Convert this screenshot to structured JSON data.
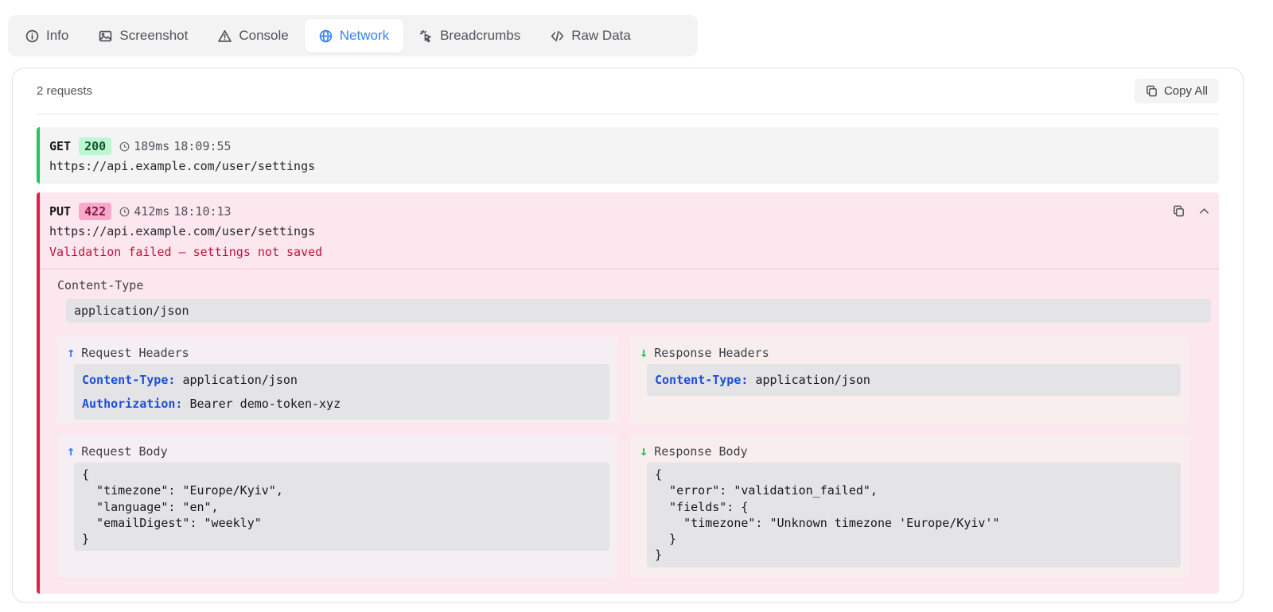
{
  "tabs": [
    {
      "label": "Info",
      "icon": "info-icon",
      "active": false
    },
    {
      "label": "Screenshot",
      "icon": "image-icon",
      "active": false
    },
    {
      "label": "Console",
      "icon": "warning-triangle-icon",
      "active": false
    },
    {
      "label": "Network",
      "icon": "globe-icon",
      "active": true
    },
    {
      "label": "Breadcrumbs",
      "icon": "pointer-click-icon",
      "active": false
    },
    {
      "label": "Raw Data",
      "icon": "code-icon",
      "active": false
    }
  ],
  "network": {
    "request_count": "2 requests",
    "copy_all_label": "Copy All",
    "requests": [
      {
        "method": "GET",
        "status": "200",
        "status_color": "#22c55e",
        "duration": "189ms",
        "time": "18:09:55",
        "url": "https://api.example.com/user/settings"
      },
      {
        "method": "PUT",
        "status": "422",
        "status_color": "#e11d48",
        "duration": "412ms",
        "time": "18:10:13",
        "url": "https://api.example.com/user/settings",
        "error": "Validation failed — settings not saved",
        "expanded": true,
        "content_type_label": "Content-Type",
        "content_type_value": "application/json",
        "request_headers_title": "Request Headers",
        "response_headers_title": "Response Headers",
        "request_headers": [
          {
            "key": "Content-Type:",
            "value": "application/json"
          },
          {
            "key": "Authorization:",
            "value": "Bearer demo-token-xyz"
          }
        ],
        "response_headers": [
          {
            "key": "Content-Type:",
            "value": "application/json"
          }
        ],
        "request_body_title": "Request Body",
        "response_body_title": "Response Body",
        "request_body": [
          "{",
          "  \"timezone\": \"Europe/Kyiv\",",
          "  \"language\": \"en\",",
          "  \"emailDigest\": \"weekly\"",
          "}"
        ],
        "response_body": [
          "{",
          "  \"error\": \"validation_failed\",",
          "  \"fields\": {",
          "    \"timezone\": \"Unknown timezone 'Europe/Kyiv'\"",
          "  }",
          "}"
        ]
      }
    ]
  },
  "colors": {
    "accent": "#3b82f6",
    "success": "#22c55e",
    "error": "#e11d48",
    "header_key": "#1d4ed8"
  }
}
